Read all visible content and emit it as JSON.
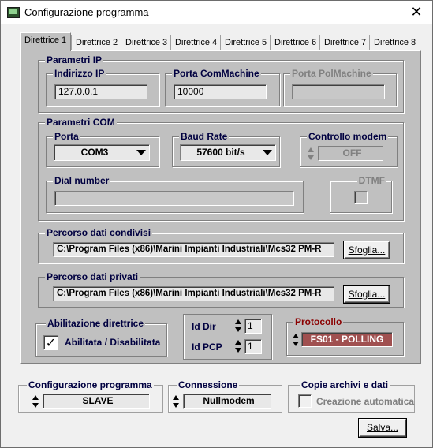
{
  "window": {
    "title": "Configurazione programma",
    "close_glyph": "✕"
  },
  "tabs": [
    {
      "label": "Direttrice 1"
    },
    {
      "label": "Direttrice 2"
    },
    {
      "label": "Direttrice 3"
    },
    {
      "label": "Direttrice 4"
    },
    {
      "label": "Direttrice 5"
    },
    {
      "label": "Direttrice 6"
    },
    {
      "label": "Direttrice 7"
    },
    {
      "label": "Direttrice 8"
    }
  ],
  "ip": {
    "group_title": "Parametri IP",
    "address_label": "Indirizzo IP",
    "address_value": "127.0.0.1",
    "port_cm_label": "Porta ComMachine",
    "port_cm_value": "10000",
    "port_pol_label": "Porta PolMachine",
    "port_pol_value": ""
  },
  "com": {
    "group_title": "Parametri COM",
    "port_label": "Porta",
    "port_value": "COM3",
    "baud_label": "Baud Rate",
    "baud_value": "57600 bit/s",
    "modem_label": "Controllo modem",
    "modem_value": "OFF",
    "dial_label": "Dial number",
    "dial_value": "",
    "dtmf_label": "DTMF"
  },
  "shared": {
    "group_title": "Percorso dati condivisi",
    "path": "C:\\Program Files (x86)\\Marini Impianti Industriali\\Mcs32 PM-R",
    "browse_label": "Sfoglia..."
  },
  "private": {
    "group_title": "Percorso dati privati",
    "path": "C:\\Program Files (x86)\\Marini Impianti Industriali\\Mcs32 PM-R",
    "browse_label": "Sfoglia..."
  },
  "enable": {
    "group_title": "Abilitazione direttrice",
    "checkbox_label": "Abilitata / Disabilitata",
    "checked_glyph": "✓"
  },
  "ids": {
    "dir_label": "Id Dir",
    "dir_value": "1",
    "pcp_label": "Id PCP",
    "pcp_value": "1"
  },
  "protocol": {
    "group_title": "Protocollo",
    "value": "FS01 - POLLING"
  },
  "config": {
    "group_title": "Configurazione programma",
    "value": "SLAVE"
  },
  "connection": {
    "group_title": "Connessione",
    "value": "Nullmodem"
  },
  "copies": {
    "group_title": "Copie archivi e dati",
    "checkbox_label": "Creazione automatica"
  },
  "save_label": "Salva...",
  "colors": {
    "panel": "#c0c0c0",
    "window": "#f0f0f0",
    "protocol_bg": "#a05050",
    "protocol_text": "#ffffff",
    "protocol_title": "#8b0000"
  }
}
